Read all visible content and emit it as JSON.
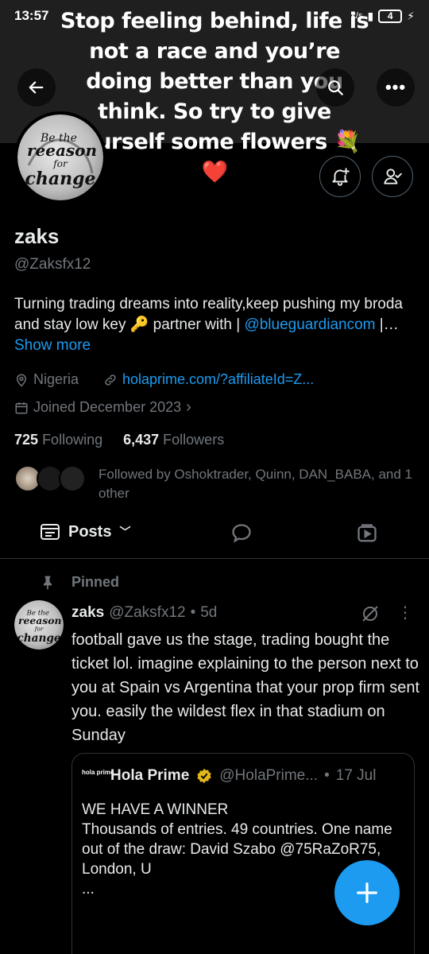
{
  "status": {
    "time": "13:57",
    "battery": "4",
    "speed": "k/s"
  },
  "banner": {
    "caption": "Stop feeling behind, life is not a race and you’re doing better than you think. So try to give yourself some flowers 💐❤️"
  },
  "profile": {
    "avatar_text": "Be the reeason for change",
    "name": "zaks",
    "handle": "@Zaksfx12",
    "bio_text": "Turning trading dreams into reality,keep pushing my broda and stay low key 🔑 partner with |",
    "bio_link": "@blueguardiancom",
    "bio_ellipsis": " |…",
    "show_more": "Show more",
    "location": "Nigeria",
    "website": "holaprime.com/?affiliateId=Z...",
    "joined": "Joined December 2023",
    "following_count": "725",
    "following_label": "Following",
    "followers_count": "6,437",
    "followers_label": "Followers",
    "followed_by": "Followed by Oshoktrader, Quinn, DAN_BABA, and 1 other"
  },
  "tabs": {
    "posts_label": "Posts"
  },
  "post": {
    "pinned_label": "Pinned",
    "author_name": "zaks",
    "author_handle": "@Zaksfx12",
    "dot": "•",
    "age": "5d",
    "text": "football gave us the stage, trading bought the ticket lol. imagine explaining to the person next to you at Spain vs Argentina that your prop firm sent you. easily the wildest flex in that stadium on Sunday",
    "quote": {
      "logo_text": "hola prime",
      "name": "Hola Prime",
      "handle": "@HolaPrime...",
      "dot": "•",
      "date": "17 Jul",
      "text_line1": "WE HAVE A WINNER",
      "text_line2": "Thousands of entries. 49 countries. One name out of the draw: David Szabo @75RaZoR75, London, U",
      "text_line3": "..."
    }
  },
  "colors": {
    "accent": "#1d9bf0",
    "muted": "#71767b",
    "verified": "#e2b719"
  }
}
